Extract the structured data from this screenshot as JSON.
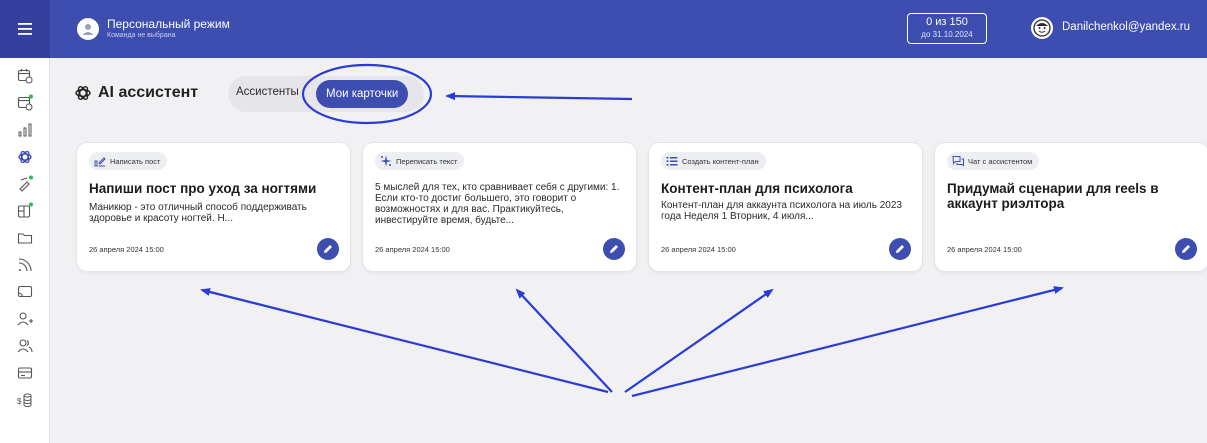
{
  "header": {
    "mode_title": "Персональный режим",
    "mode_subtitle": "Команда не выбрана",
    "limit_count": "0 из 150",
    "limit_date": "до 31.10.2024",
    "user_email": "Danilchenkol@yandex.ru"
  },
  "sidebar": {
    "items": [
      {
        "icon": "calendar-clock-icon"
      },
      {
        "icon": "calendar-dot-icon"
      },
      {
        "icon": "bar-chart-icon"
      },
      {
        "icon": "ai-assistant-icon",
        "active": true
      },
      {
        "icon": "magic-wand-icon"
      },
      {
        "icon": "template-icon"
      },
      {
        "icon": "folder-icon"
      },
      {
        "icon": "rss-icon"
      },
      {
        "icon": "cast-icon"
      },
      {
        "icon": "add-user-icon"
      },
      {
        "icon": "users-icon"
      },
      {
        "icon": "card-icon"
      },
      {
        "icon": "coins-icon"
      }
    ]
  },
  "page": {
    "title": "AI ассистент",
    "tabs": [
      {
        "label": "Ассистенты"
      },
      {
        "label": "Мои карточки",
        "selected": true
      }
    ]
  },
  "cards": [
    {
      "chip_icon": "write-post-icon",
      "chip_label": "Написать пост",
      "title": "Напиши пост про уход за ногтями",
      "body": "Маникюр - это отличный способ поддерживать здоровье и красоту ногтей. Н...",
      "date": "26 апреля 2024 15:00"
    },
    {
      "chip_icon": "rewrite-sparkle-icon",
      "chip_label": "Переписать текст",
      "title": "",
      "body": "5 мыслей для тех, кто сравнивает себя с другими: 1. Если кто-то достиг большего, это говорит о возможностях и для вас. Практикуйтесь, инвестируйте время, будьте...",
      "date": "26 апреля 2024 15:00"
    },
    {
      "chip_icon": "list-icon",
      "chip_label": "Создать контент-план",
      "title": "Контент-план для психолога",
      "body": "Контент-план для аккаунта психолога на июль 2023 года Неделя 1 Вторник, 4 июля...",
      "date": "26 апреля 2024 15:00"
    },
    {
      "chip_icon": "chat-icon",
      "chip_label": "Чат с ассистентом",
      "title": "Придумай сценарии для reels в аккаунт риэлтора",
      "body": "",
      "date": "26 апреля 2024 15:00"
    }
  ],
  "colors": {
    "brand": "#3d4db0",
    "annotation": "#2a3bd6"
  }
}
